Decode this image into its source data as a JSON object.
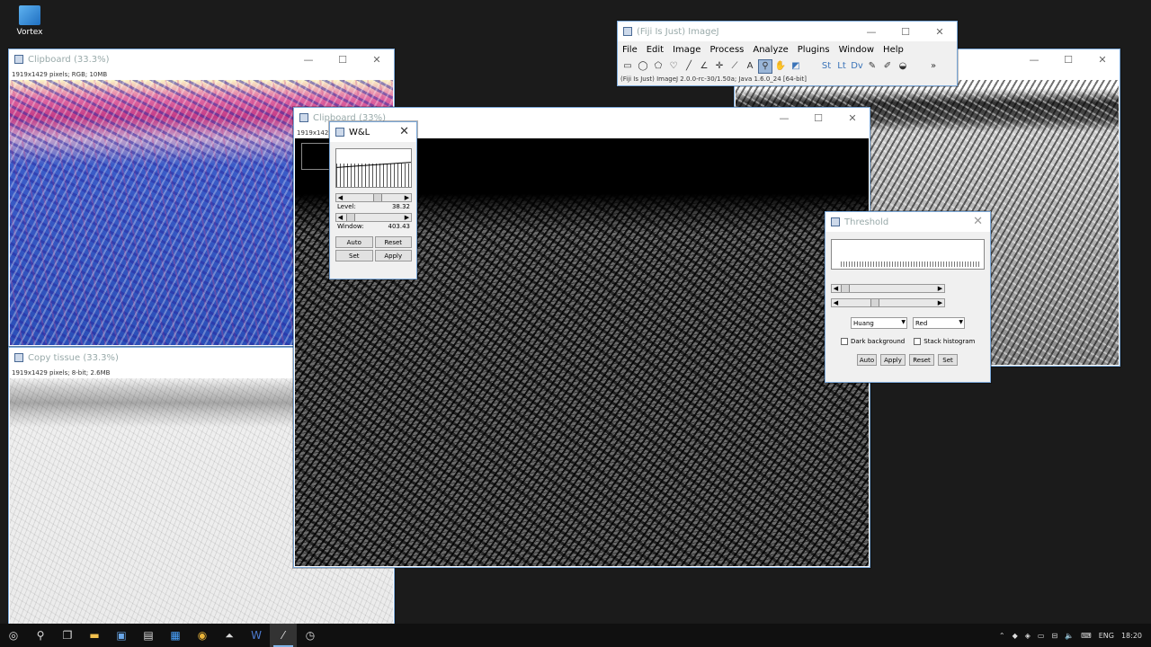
{
  "desktop": {
    "icon_label": "Vortex"
  },
  "windows": {
    "clipboard1": {
      "title": "Clipboard (33.3%)",
      "info": "1919x1429 pixels; RGB; 10MB"
    },
    "copy_tissue": {
      "title": "Copy tissue (33.3%)",
      "info": "1919x1429 pixels; 8-bit; 2.6MB"
    },
    "clipboard2": {
      "title": "Clipboard (33%)",
      "info": "1919x142"
    }
  },
  "imagej": {
    "title": "(Fiji Is Just) ImageJ",
    "menus": [
      "File",
      "Edit",
      "Image",
      "Process",
      "Analyze",
      "Plugins",
      "Window",
      "Help"
    ],
    "status": "(Fiji Is Just) ImageJ 2.0.0-rc-30/1.50a; Java 1.6.0_24 [64-bit]"
  },
  "wl": {
    "title": "W&L",
    "level_label": "Level:",
    "level_value": "38.32",
    "window_label": "Window:",
    "window_value": "403.43",
    "buttons": {
      "auto": "Auto",
      "reset": "Reset",
      "set": "Set",
      "apply": "Apply"
    }
  },
  "threshold": {
    "title": "Threshold",
    "method": "Huang",
    "color": "Red",
    "dark_background": "Dark background",
    "stack_histogram": "Stack histogram",
    "buttons": {
      "auto": "Auto",
      "apply": "Apply",
      "reset": "Reset",
      "set": "Set"
    }
  },
  "taskbar": {
    "lang": "ENG",
    "time": "18:20"
  },
  "icons": {
    "close": "✕",
    "minimize": "—",
    "maximize": "☐"
  }
}
